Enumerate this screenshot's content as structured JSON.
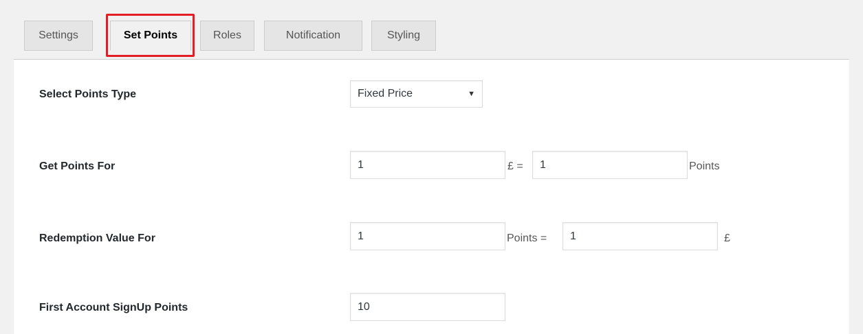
{
  "tabs": [
    {
      "label": "Settings",
      "active": false
    },
    {
      "label": "Set Points",
      "active": true
    },
    {
      "label": "Roles",
      "active": false
    },
    {
      "label": "Notification",
      "active": false
    },
    {
      "label": "Styling",
      "active": false
    }
  ],
  "colors": {
    "highlight": "#e31d23",
    "panel_bg": "#ffffff",
    "page_bg": "#f1f1f1"
  },
  "form": {
    "points_type": {
      "label": "Select Points Type",
      "selected": "Fixed Price",
      "caret_icon": "caret-down-icon"
    },
    "get_points": {
      "label": "Get Points For",
      "amount": "1",
      "currency_equals": "£ =",
      "points": "1",
      "unit": "Points"
    },
    "redemption": {
      "label": "Redemption Value For",
      "points": "1",
      "points_equals": "Points =",
      "amount": "1",
      "currency": "£"
    },
    "signup": {
      "label": "First Account SignUp Points",
      "points": "10"
    }
  }
}
